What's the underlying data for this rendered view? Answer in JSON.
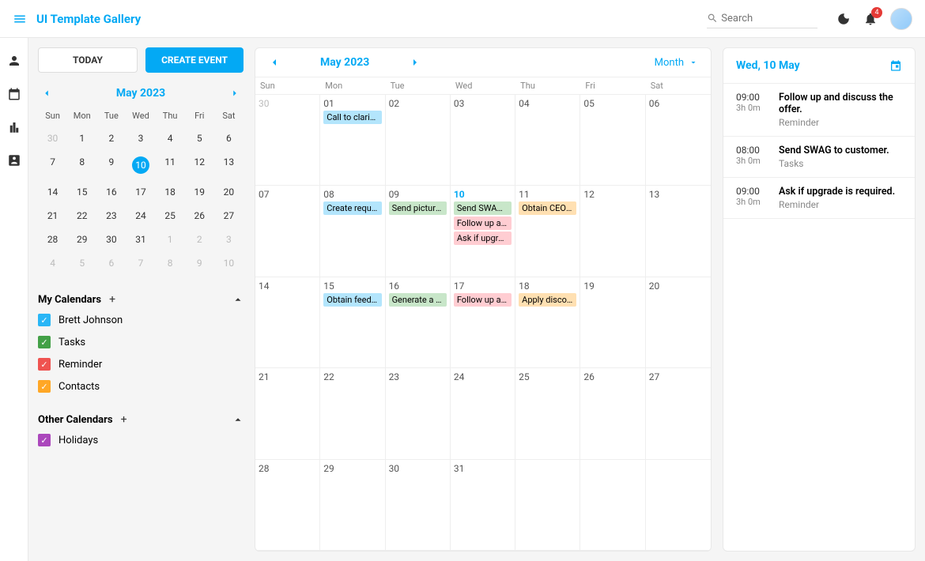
{
  "header": {
    "brand": "UI Template Gallery",
    "search_placeholder": "Search",
    "notification_count": "4"
  },
  "sidebar": {
    "today_label": "TODAY",
    "create_label": "CREATE EVENT",
    "mini_month": "May 2023",
    "dow": [
      "Sun",
      "Mon",
      "Tue",
      "Wed",
      "Thu",
      "Fri",
      "Sat"
    ],
    "mini_days": [
      {
        "d": "30",
        "muted": true
      },
      {
        "d": "1"
      },
      {
        "d": "2"
      },
      {
        "d": "3"
      },
      {
        "d": "4"
      },
      {
        "d": "5"
      },
      {
        "d": "6"
      },
      {
        "d": "7"
      },
      {
        "d": "8"
      },
      {
        "d": "9"
      },
      {
        "d": "10",
        "selected": true
      },
      {
        "d": "11"
      },
      {
        "d": "12"
      },
      {
        "d": "13"
      },
      {
        "d": "14"
      },
      {
        "d": "15"
      },
      {
        "d": "16"
      },
      {
        "d": "17"
      },
      {
        "d": "18"
      },
      {
        "d": "19"
      },
      {
        "d": "20"
      },
      {
        "d": "21"
      },
      {
        "d": "22"
      },
      {
        "d": "23"
      },
      {
        "d": "24"
      },
      {
        "d": "25"
      },
      {
        "d": "26"
      },
      {
        "d": "27"
      },
      {
        "d": "28"
      },
      {
        "d": "29"
      },
      {
        "d": "30"
      },
      {
        "d": "31"
      },
      {
        "d": "1",
        "muted": true
      },
      {
        "d": "2",
        "muted": true
      },
      {
        "d": "3",
        "muted": true
      },
      {
        "d": "4",
        "muted": true
      },
      {
        "d": "5",
        "muted": true
      },
      {
        "d": "6",
        "muted": true
      },
      {
        "d": "7",
        "muted": true
      },
      {
        "d": "8",
        "muted": true
      },
      {
        "d": "9",
        "muted": true
      },
      {
        "d": "10",
        "muted": true
      }
    ],
    "my_calendars_title": "My Calendars",
    "other_calendars_title": "Other Calendars",
    "my_calendars": [
      {
        "label": "Brett Johnson",
        "color": "#29b6f6"
      },
      {
        "label": "Tasks",
        "color": "#43a047"
      },
      {
        "label": "Reminder",
        "color": "#ef5350"
      },
      {
        "label": "Contacts",
        "color": "#ffa726"
      }
    ],
    "other_calendars": [
      {
        "label": "Holidays",
        "color": "#ab47bc"
      }
    ]
  },
  "calendar": {
    "month": "May 2023",
    "view_label": "Month",
    "dow": [
      "Sun",
      "Mon",
      "Tue",
      "Wed",
      "Thu",
      "Fri",
      "Sat"
    ],
    "weeks": [
      [
        {
          "d": "30",
          "muted": true,
          "events": []
        },
        {
          "d": "01",
          "events": [
            {
              "t": "Call to clarify …",
              "c": "#b3e5fc"
            }
          ]
        },
        {
          "d": "02",
          "events": []
        },
        {
          "d": "03",
          "events": []
        },
        {
          "d": "04",
          "events": []
        },
        {
          "d": "05",
          "events": []
        },
        {
          "d": "06",
          "events": []
        }
      ],
      [
        {
          "d": "07",
          "events": []
        },
        {
          "d": "08",
          "events": [
            {
              "t": "Create reques…",
              "c": "#b3e5fc"
            }
          ]
        },
        {
          "d": "09",
          "events": [
            {
              "t": "Send pictures…",
              "c": "#c8e6c9"
            }
          ]
        },
        {
          "d": "10",
          "today": true,
          "events": [
            {
              "t": "Send SWAG t…",
              "c": "#c8e6c9"
            },
            {
              "t": "Follow up and…",
              "c": "#ffcdd2"
            },
            {
              "t": "Ask if upgrad…",
              "c": "#ffcdd2"
            }
          ]
        },
        {
          "d": "11",
          "events": [
            {
              "t": "Obtain CEO c…",
              "c": "#ffe0b2"
            }
          ]
        },
        {
          "d": "12",
          "events": []
        },
        {
          "d": "13",
          "events": []
        }
      ],
      [
        {
          "d": "14",
          "events": []
        },
        {
          "d": "15",
          "events": [
            {
              "t": "Obtain feedb…",
              "c": "#b3e5fc"
            }
          ]
        },
        {
          "d": "16",
          "events": [
            {
              "t": "Generate a qu…",
              "c": "#c8e6c9"
            }
          ]
        },
        {
          "d": "17",
          "events": [
            {
              "t": "Follow up and…",
              "c": "#ffcdd2"
            }
          ]
        },
        {
          "d": "18",
          "events": [
            {
              "t": "Apply discou…",
              "c": "#ffe0b2"
            }
          ]
        },
        {
          "d": "19",
          "events": []
        },
        {
          "d": "20",
          "events": []
        }
      ],
      [
        {
          "d": "21",
          "events": []
        },
        {
          "d": "22",
          "events": []
        },
        {
          "d": "23",
          "events": []
        },
        {
          "d": "24",
          "events": []
        },
        {
          "d": "25",
          "events": []
        },
        {
          "d": "26",
          "events": []
        },
        {
          "d": "27",
          "events": []
        }
      ],
      [
        {
          "d": "28",
          "events": []
        },
        {
          "d": "29",
          "events": []
        },
        {
          "d": "30",
          "events": []
        },
        {
          "d": "31",
          "events": []
        },
        {
          "d": "",
          "events": []
        },
        {
          "d": "",
          "events": []
        },
        {
          "d": "",
          "events": []
        }
      ]
    ]
  },
  "agenda": {
    "title": "Wed, 10 May",
    "items": [
      {
        "time": "09:00",
        "dur": "3h 0m",
        "title": "Follow up and discuss the offer.",
        "type": "Reminder"
      },
      {
        "time": "08:00",
        "dur": "3h 0m",
        "title": "Send SWAG to customer.",
        "type": "Tasks"
      },
      {
        "time": "09:00",
        "dur": "3h 0m",
        "title": "Ask if upgrade is required.",
        "type": "Reminder"
      }
    ]
  }
}
